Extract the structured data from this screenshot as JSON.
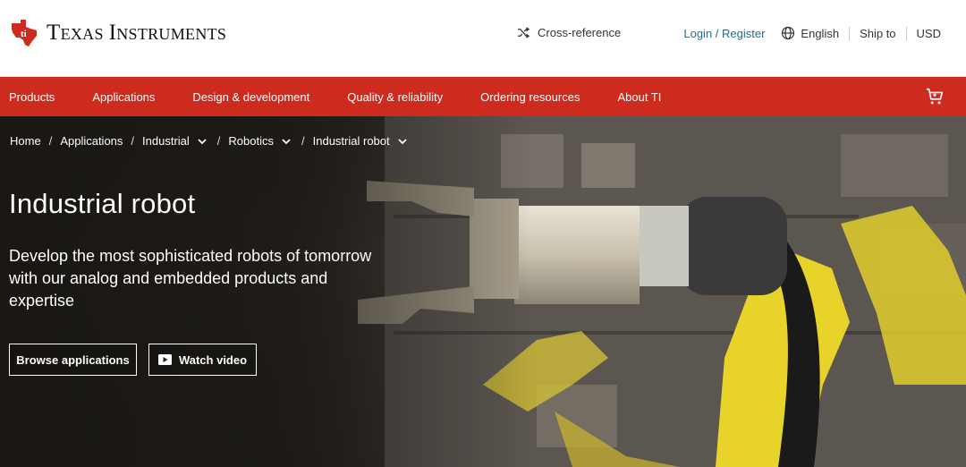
{
  "brand": {
    "name_a": "Texas",
    "name_b": "Instruments",
    "logo_icon": "ti-state-logo-icon",
    "color": "#cc2b1e"
  },
  "header": {
    "cross_reference": "Cross-reference",
    "login": "Login / Register",
    "language": "English",
    "ship_to": "Ship to",
    "currency": "USD"
  },
  "nav": {
    "items": [
      "Products",
      "Applications",
      "Design & development",
      "Quality & reliability",
      "Ordering resources",
      "About TI"
    ],
    "cart_icon": "shopping-cart-icon"
  },
  "breadcrumb": [
    "Home",
    "Applications",
    "Industrial",
    "Robotics",
    "Industrial robot"
  ],
  "hero": {
    "title": "Industrial robot",
    "description": "Develop the most sophisticated robots of tomorrow with our analog and embedded products and expertise",
    "browse_label": "Browse applications",
    "watch_label": "Watch video"
  }
}
